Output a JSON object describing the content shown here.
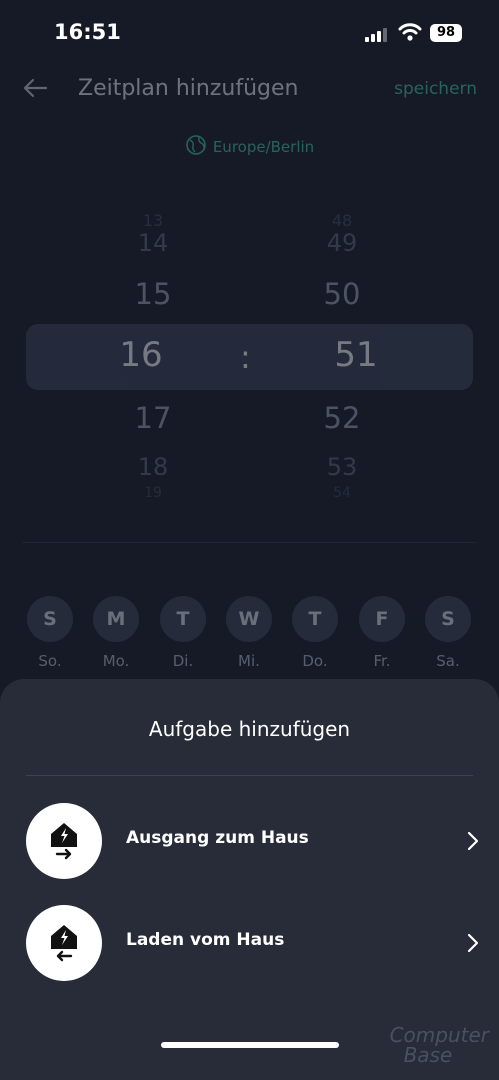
{
  "status_bar": {
    "time": "16:51",
    "battery": "98"
  },
  "header": {
    "title": "Zeitplan hinzufügen",
    "save_label": "speichern"
  },
  "timezone": "Europe/Berlin",
  "time_picker": {
    "hours": [
      "13",
      "14",
      "15",
      "16",
      "17",
      "18",
      "19"
    ],
    "minutes": [
      "48",
      "49",
      "50",
      "51",
      "52",
      "53",
      "54"
    ],
    "separator": ":",
    "selected_hour": "16",
    "selected_minute": "51"
  },
  "weekdays": [
    {
      "letter": "S",
      "label": "So."
    },
    {
      "letter": "M",
      "label": "Mo."
    },
    {
      "letter": "T",
      "label": "Di."
    },
    {
      "letter": "W",
      "label": "Mi."
    },
    {
      "letter": "T",
      "label": "Do."
    },
    {
      "letter": "F",
      "label": "Fr."
    },
    {
      "letter": "S",
      "label": "Sa."
    }
  ],
  "sheet": {
    "title": "Aufgabe hinzufügen",
    "tasks": [
      {
        "label": "Ausgang zum Haus",
        "icon": "house-export-icon"
      },
      {
        "label": "Laden vom Haus",
        "icon": "house-import-icon"
      }
    ]
  },
  "watermark": {
    "line1": "Computer",
    "line2": "Base"
  },
  "colors": {
    "accent": "#43c8a8",
    "background": "#151a26",
    "sheet": "#272c38"
  }
}
